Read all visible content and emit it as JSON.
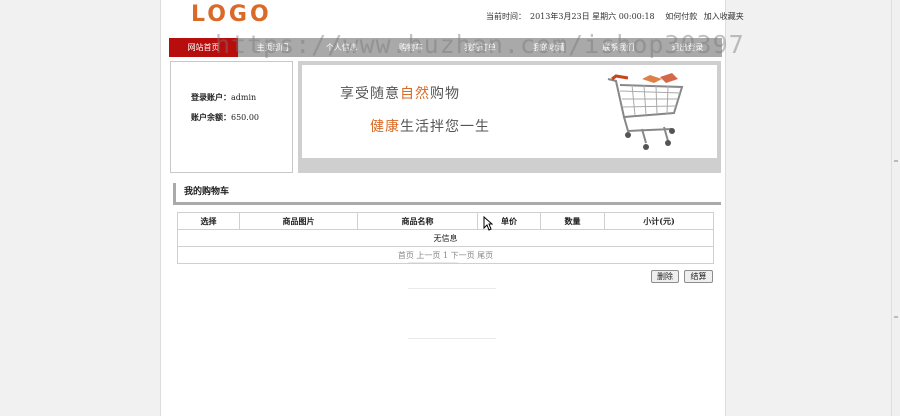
{
  "header": {
    "logo": "LOGO",
    "time_label": "当前时间：",
    "time_value": "2013年3月23日 星期六 00:00:18",
    "link_pay": "如何付款",
    "link_favorite": "加入收藏夹"
  },
  "nav": {
    "items": [
      "网站首页",
      "主页部门",
      "个人信息",
      "购物车",
      "我的订单",
      "我的收藏",
      "联系我们",
      "退出登录"
    ],
    "active_index": 0
  },
  "watermark": "https://www.huzhan.com/ishop30397",
  "account": {
    "user_label": "登录账户：",
    "user_value": "admin",
    "balance_label": "账户余额：",
    "balance_value": "650.00"
  },
  "banner": {
    "line1_pre": "享受随意",
    "line1_hl": "自然",
    "line1_post": "购物",
    "line2_hl": "健康",
    "line2_post": "生活拌您一生"
  },
  "cart": {
    "title": "我的购物车",
    "columns": [
      "选择",
      "商品图片",
      "商品名称",
      "单价",
      "数量",
      "小计(元)"
    ],
    "empty_text": "无信息",
    "pager": "首页 上一页 1 下一页 尾页"
  },
  "buttons": {
    "delete": "删除",
    "checkout": "结算"
  },
  "colors": {
    "accent": "#d96a28",
    "nav_active": "#b80d0d",
    "nav_bg": "#a9a9a9"
  }
}
